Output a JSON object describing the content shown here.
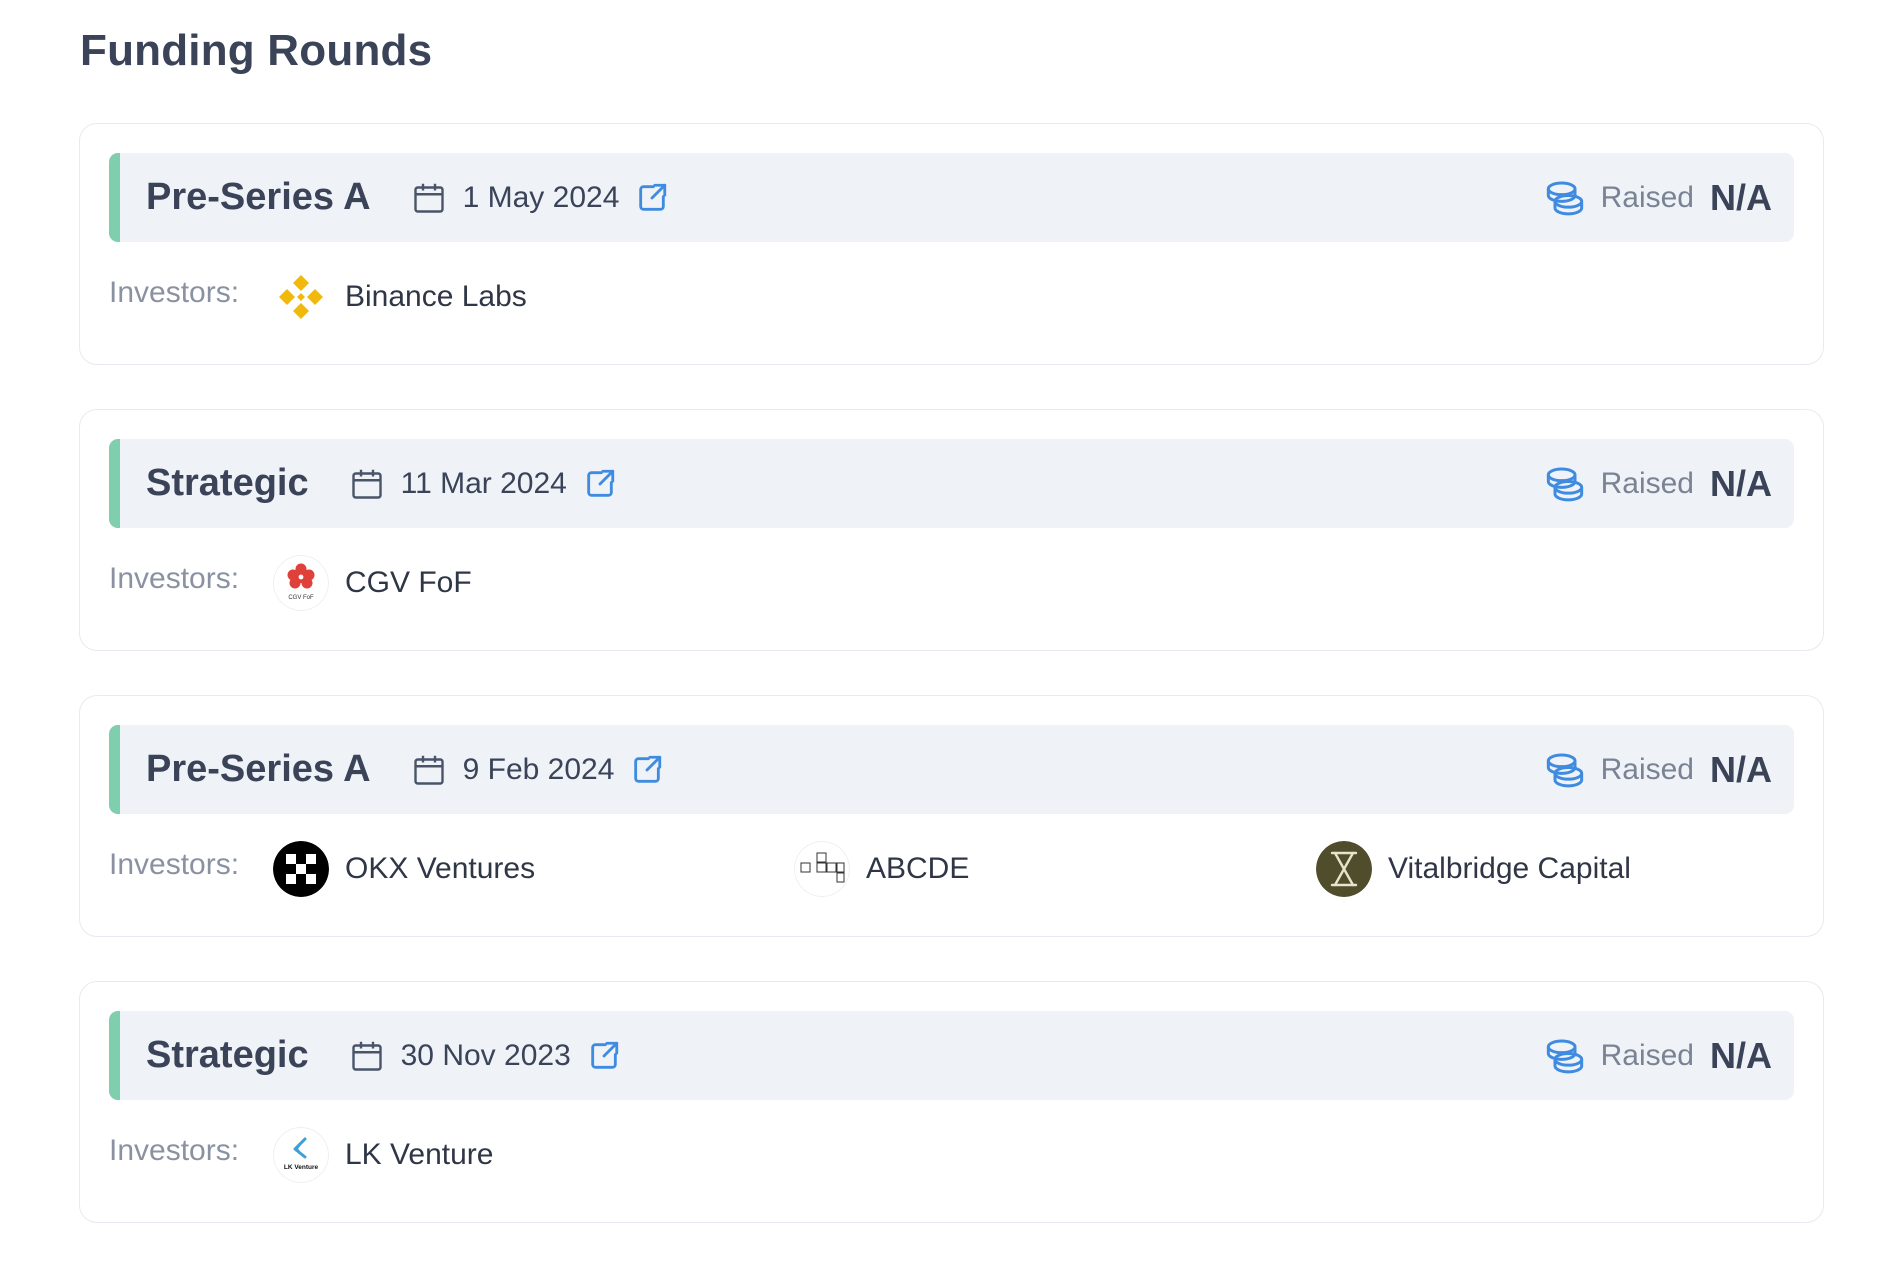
{
  "section": {
    "title": "Funding Rounds"
  },
  "labels": {
    "investors": "Investors:",
    "raised": "Raised"
  },
  "colors": {
    "accent_bar": "#7fcfae",
    "icon_blue": "#3f8be0",
    "header_bg": "#eff3f8"
  },
  "rounds": [
    {
      "type": "Pre-Series A",
      "date": "1 May 2024",
      "raised": "N/A",
      "investors": [
        {
          "name": "Binance Labs",
          "logo": "binance-labs-logo"
        }
      ]
    },
    {
      "type": "Strategic",
      "date": "11 Mar 2024",
      "raised": "N/A",
      "investors": [
        {
          "name": "CGV FoF",
          "logo": "cgv-fof-logo",
          "logo_text": "CGV FoF"
        }
      ]
    },
    {
      "type": "Pre-Series A",
      "date": "9 Feb 2024",
      "raised": "N/A",
      "investors": [
        {
          "name": "OKX Ventures",
          "logo": "okx-ventures-logo"
        },
        {
          "name": "ABCDE",
          "logo": "abcde-logo"
        },
        {
          "name": "Vitalbridge Capital",
          "logo": "vitalbridge-capital-logo"
        }
      ]
    },
    {
      "type": "Strategic",
      "date": "30 Nov 2023",
      "raised": "N/A",
      "investors": [
        {
          "name": "LK Venture",
          "logo": "lk-venture-logo",
          "logo_text": "LK Venture"
        }
      ]
    }
  ]
}
